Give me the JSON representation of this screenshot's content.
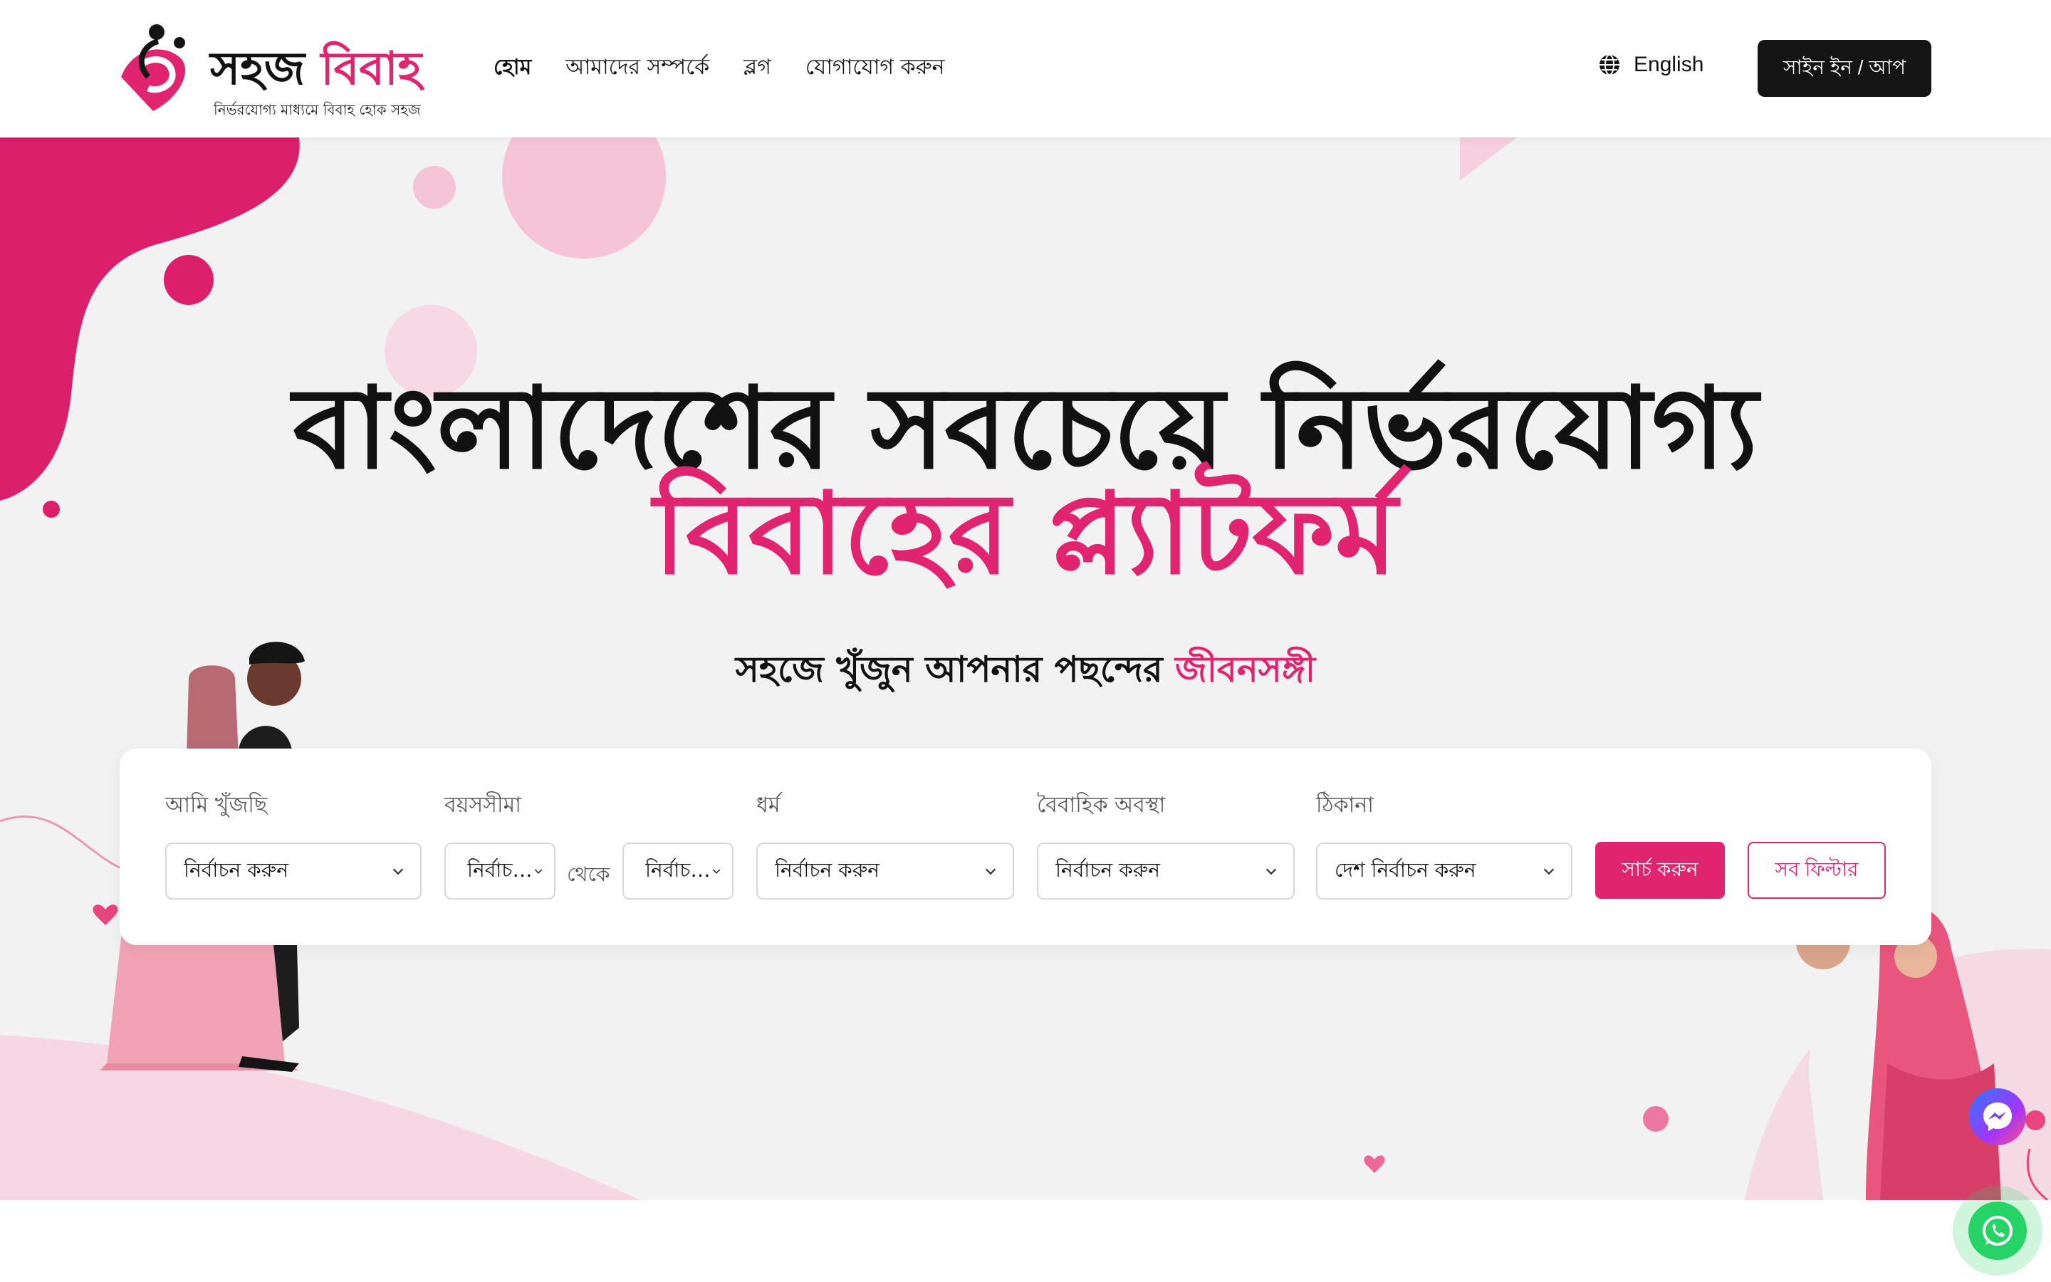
{
  "header": {
    "logo": {
      "name_part1": "সহজ",
      "name_part2": "বিবাহ",
      "tagline": "নির্ভরযোগ্য মাধ্যমে বিবাহ হোক সহজ"
    },
    "nav": [
      {
        "label": "হোম",
        "active": true
      },
      {
        "label": "আমাদের সম্পর্কে",
        "active": false
      },
      {
        "label": "ব্লগ",
        "active": false
      },
      {
        "label": "যোগাযোগ করুন",
        "active": false
      }
    ],
    "language": {
      "icon": "globe-icon",
      "label": "English"
    },
    "signin_label": "সাইন ইন / আপ"
  },
  "hero": {
    "headline_line1": "বাংলাদেশের সবচেয়ে নির্ভরযোগ্য",
    "headline_line2": "বিবাহের প্ল্যাটফর্ম",
    "subheading_prefix": "সহজে খুঁজুন আপনার পছন্দের ",
    "subheading_highlight": "জীবনসঙ্গী"
  },
  "search": {
    "looking_for": {
      "label": "আমি খুঁজছি",
      "value": "নির্বাচন করুন"
    },
    "age_range": {
      "label": "বয়সসীমা",
      "from_value": "নির্বাচন করুন",
      "between_label": "থেকে",
      "to_value": "নির্বাচন করুন"
    },
    "religion": {
      "label": "ধর্ম",
      "value": "নির্বাচন করুন"
    },
    "marital_status": {
      "label": "বৈবাহিক অবস্থা",
      "value": "নির্বাচন করুন"
    },
    "location": {
      "label": "ঠিকানা",
      "value": "দেশ নির্বাচন করুন"
    },
    "search_button": "সার্চ করুন",
    "all_filters_button": "সব ফিল্টার"
  },
  "floating": {
    "messenger_icon": "messenger-icon",
    "whatsapp_icon": "whatsapp-icon"
  },
  "colors": {
    "brand_pink": "#e0246f",
    "dark": "#141414",
    "hero_bg": "#f3f2f3"
  }
}
